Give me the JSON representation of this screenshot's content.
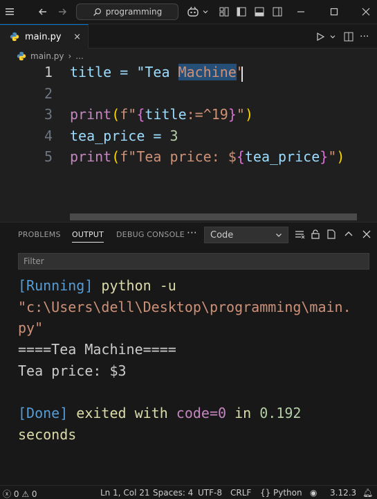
{
  "titlebar": {
    "search_text": "programming"
  },
  "tabs": [
    {
      "label": "main.py",
      "close": "×"
    }
  ],
  "breadcrumb": {
    "file": "main.py",
    "more": "..."
  },
  "editor": {
    "line_numbers": [
      "1",
      "2",
      "3",
      "4",
      "5"
    ],
    "lines": {
      "l1_a": "title = \"Tea ",
      "l1_sel": "Machine",
      "l1_b": "\"",
      "l3_print": "print",
      "l3_open": "(",
      "l3_f": "f\"",
      "l3_brace_open": "{",
      "l3_var": "title",
      "l3_fmt": ":=^19",
      "l3_brace_close": "}",
      "l3_end": "\"",
      "l3_close": ")",
      "l4_a": "tea_price = ",
      "l4_num": "3",
      "l5_print": "print",
      "l5_open": "(",
      "l5_str": "f\"Tea price: $",
      "l5_brace_open": "{",
      "l5_var": "tea_price",
      "l5_brace_close": "}",
      "l5_end": "\"",
      "l5_close": ")"
    }
  },
  "panel": {
    "tabs": [
      "PROBLEMS",
      "OUTPUT",
      "DEBUG CONSOLE"
    ],
    "more": "···",
    "dropdown_value": "Code",
    "filter_placeholder": "Filter",
    "output": {
      "running_tag": "[Running]",
      "running_cmd": " python -u",
      "path_1": "\"c:\\Users\\dell\\Desktop\\programming\\main.",
      "path_2": "py\"",
      "result_1": "====Tea Machine====",
      "result_2": "Tea price: $3",
      "done_tag": "[Done]",
      "done_text": " exited with ",
      "done_code": "code=0",
      "done_in": " in ",
      "done_time": "0.192",
      "done_seconds": "seconds"
    }
  },
  "statusbar": {
    "errors": "0",
    "warnings": "0",
    "position": "Ln 1, Col 21",
    "spaces": "Spaces: 4",
    "encoding": "UTF-8",
    "eol": "CRLF",
    "braces": "{}",
    "language": "Python",
    "version": "3.12.3"
  },
  "colors": {
    "accent": "#0078d4",
    "selection": "#264f78",
    "background": "#1f1f1f"
  }
}
